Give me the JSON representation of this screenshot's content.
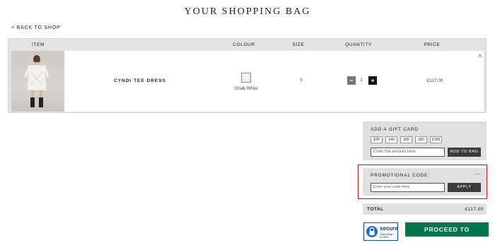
{
  "page": {
    "title": "YOUR SHOPPING BAG",
    "back_link": "< BACK TO SHOP"
  },
  "table": {
    "headers": [
      "ITEM",
      "COLOUR",
      "SIZE",
      "QUANTITY",
      "PRICE"
    ],
    "items": [
      {
        "name": "CYNDI TEE DRESS",
        "colour": "Chalk White",
        "size": "S",
        "quantity": "1",
        "price": "£117.00"
      }
    ]
  },
  "gift_card": {
    "title": "ADD A GIFT CARD",
    "amounts": [
      "£20",
      "£40",
      "£60",
      "£80",
      "£100"
    ],
    "placeholder": "Enter the amount here",
    "button": "ADD TO BAG"
  },
  "promo": {
    "title": "PROMOTIONAL CODE:",
    "placeholder": "Enter your code here",
    "button": "APPLY"
  },
  "summary": {
    "total_label": "TOTAL",
    "total_value": "£117.00"
  },
  "secure": {
    "title": "secure",
    "line1": "GlobalSign",
    "line2": "by GMO"
  },
  "checkout": {
    "label": "PROCEED TO CHECKOUT"
  },
  "icons": {
    "remove": "close-icon",
    "minus": "minus-icon",
    "plus": "plus-icon",
    "lock": "lock-icon"
  },
  "colors": {
    "checkout": "#04764a",
    "highlight": "#c0101a",
    "panel": "#e0e0e0"
  }
}
